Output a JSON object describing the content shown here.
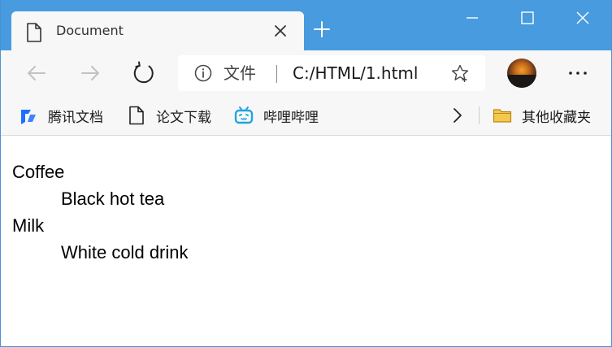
{
  "tab": {
    "title": "Document",
    "icon": "document-icon"
  },
  "toolbar": {
    "address_label": "文件",
    "url": "C:/HTML/1.html"
  },
  "bookmarks": {
    "items": [
      {
        "label": "腾讯文档",
        "icon": "tencent-docs-icon"
      },
      {
        "label": "论文下载",
        "icon": "document-icon"
      },
      {
        "label": "哔哩哔哩",
        "icon": "bilibili-icon"
      }
    ],
    "other": {
      "label": "其他收藏夹",
      "icon": "folder-icon"
    }
  },
  "content": {
    "items": [
      {
        "term": "Coffee",
        "desc": "Black hot tea"
      },
      {
        "term": "Milk",
        "desc": "White cold drink"
      }
    ]
  },
  "colors": {
    "titlebar": "#479bde",
    "toolbar": "#f7f7f7",
    "tencent_docs": "#1e6fff",
    "bilibili": "#21a5e0",
    "folder": "#f5c84c"
  }
}
